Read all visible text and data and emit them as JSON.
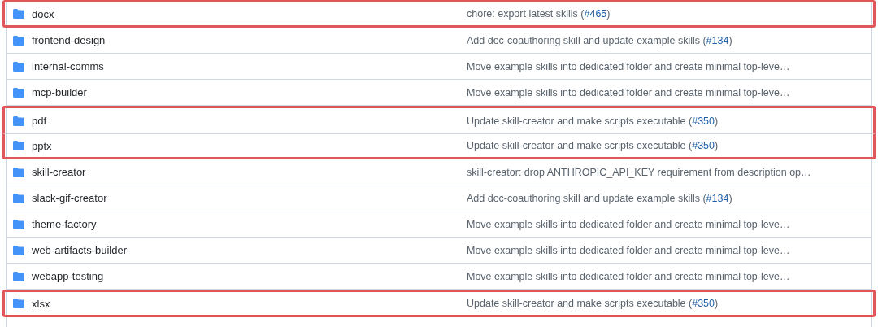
{
  "rows": [
    {
      "name": "docx",
      "message": "chore: export latest skills (",
      "link": "#465",
      "tail": ")",
      "highlighted": true
    },
    {
      "name": "frontend-design",
      "message": "Add doc-coauthoring skill and update example skills (",
      "link": "#134",
      "tail": ")",
      "highlighted": false
    },
    {
      "name": "internal-comms",
      "message": "Move example skills into dedicated folder and create minimal top-leve…",
      "highlighted": false
    },
    {
      "name": "mcp-builder",
      "message": "Move example skills into dedicated folder and create minimal top-leve…",
      "highlighted": false
    },
    {
      "name": "pdf",
      "message": "Update skill-creator and make scripts executable (",
      "link": "#350",
      "tail": ")",
      "highlighted": true
    },
    {
      "name": "pptx",
      "message": "Update skill-creator and make scripts executable (",
      "link": "#350",
      "tail": ")",
      "highlighted": true
    },
    {
      "name": "skill-creator",
      "message": "skill-creator: drop ANTHROPIC_API_KEY requirement from description op…",
      "highlighted": false
    },
    {
      "name": "slack-gif-creator",
      "message": "Add doc-coauthoring skill and update example skills (",
      "link": "#134",
      "tail": ")",
      "highlighted": false
    },
    {
      "name": "theme-factory",
      "message": "Move example skills into dedicated folder and create minimal top-leve…",
      "highlighted": false
    },
    {
      "name": "web-artifacts-builder",
      "message": "Move example skills into dedicated folder and create minimal top-leve…",
      "highlighted": false
    },
    {
      "name": "webapp-testing",
      "message": "Move example skills into dedicated folder and create minimal top-leve…",
      "highlighted": false
    },
    {
      "name": "xlsx",
      "message": "Update skill-creator and make scripts executable (",
      "link": "#350",
      "tail": ")",
      "highlighted": true
    }
  ]
}
